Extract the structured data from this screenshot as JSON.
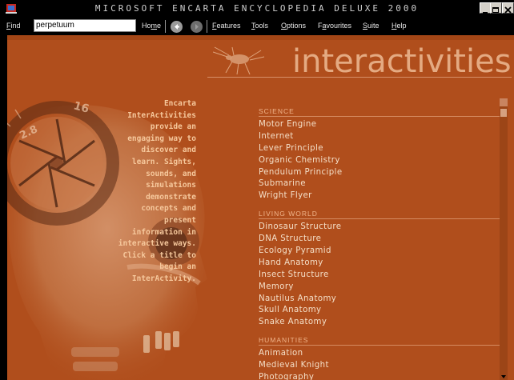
{
  "window": {
    "title": "MICROSOFT ENCARTA ENCYCLOPEDIA DELUXE 2000"
  },
  "menubar": {
    "find_label_first": "F",
    "find_label_rest": "ind",
    "find_value": "perpetuum",
    "home_a": "Ho",
    "home_u": "m",
    "home_b": "e",
    "features_u": "F",
    "features_rest": "eatures",
    "tools_u": "T",
    "tools_rest": "ools",
    "options_u": "O",
    "options_rest": "ptions",
    "favourites_a": "F",
    "favourites_u": "a",
    "favourites_b": "vourites",
    "suite_u": "S",
    "suite_rest": "uite",
    "help_u": "H",
    "help_rest": "elp"
  },
  "page": {
    "heading": "interactivities",
    "intro": "Encarta InterActivities provide an engaging way to discover and learn. Sights, sounds, and simulations demonstrate concepts and present information in interactive ways. Click a title to begin an InterActivity.",
    "dial_numbers": [
      "2.8",
      "16"
    ]
  },
  "categories": [
    {
      "name": "SCIENCE",
      "items": [
        "Motor Engine",
        "Internet",
        "Lever Principle",
        "Organic Chemistry",
        "Pendulum Principle",
        "Submarine",
        "Wright Flyer"
      ]
    },
    {
      "name": "LIVING WORLD",
      "items": [
        "Dinosaur Structure",
        "DNA Structure",
        "Ecology Pyramid",
        "Hand Anatomy",
        "Insect Structure",
        "Memory",
        "Nautilus Anatomy",
        "Skull Anatomy",
        "Snake Anatomy"
      ]
    },
    {
      "name": "HUMANITIES",
      "items": [
        "Animation",
        "Medieval Knight",
        "Photography"
      ]
    }
  ],
  "colors": {
    "background": "#b04e1c",
    "heading": "#e4aa82",
    "list_text": "#f4dfc8",
    "category_text": "#f0b48a",
    "intro_text": "#f6c89c"
  },
  "icons": [
    "encarta-app-icon",
    "minimize-icon",
    "maximize-icon",
    "close-icon",
    "back-arrow-icon",
    "forward-arrow-icon",
    "insect-illustration",
    "scroll-down-arrow-icon"
  ]
}
